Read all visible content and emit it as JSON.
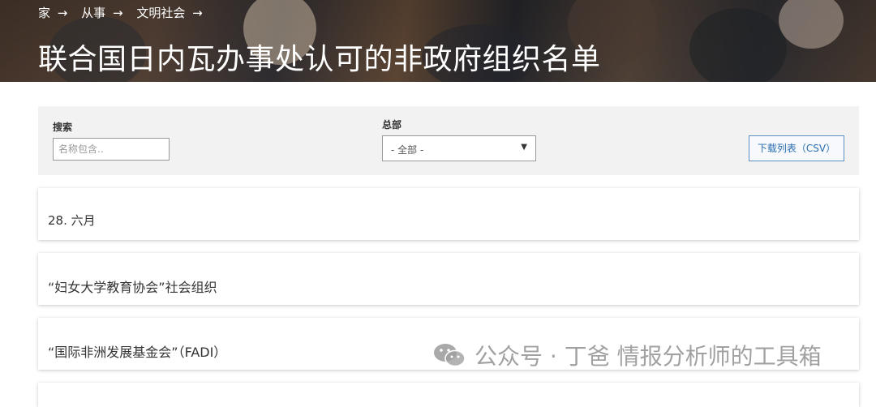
{
  "breadcrumb": {
    "items": [
      "家",
      "从事",
      "文明社会"
    ],
    "arrow": "→"
  },
  "page_title": "联合国日内瓦办事处认可的非政府组织名单",
  "filters": {
    "search_label": "搜索",
    "search_placeholder": "名称包含..",
    "search_value": "",
    "hq_label": "总部",
    "hq_selected": "- 全部 -",
    "download_label": "下载列表（CSV）"
  },
  "list": {
    "date_header": "28. 六月",
    "items": [
      "“妇女大学教育协会”社会组织",
      "“国际非洲发展基金会”（FADI）"
    ]
  },
  "watermark": {
    "text": "公众号 · 丁爸 情报分析师的工具箱"
  },
  "colors": {
    "panel_bg": "#f2f2f2",
    "button_border": "#5c8fc4",
    "button_text": "#2a6db0"
  }
}
